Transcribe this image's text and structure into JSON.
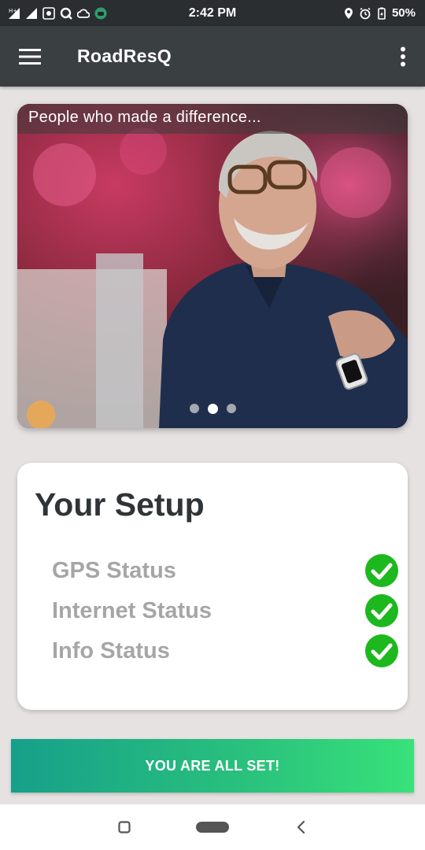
{
  "status_bar": {
    "time": "2:42 PM",
    "battery": "50%",
    "icons_left": [
      "signal-icon",
      "signal-icon",
      "app-icon",
      "q-icon",
      "cloud-icon",
      "android-icon"
    ],
    "icons_right": [
      "location-icon",
      "alarm-icon",
      "battery-icon"
    ]
  },
  "app_bar": {
    "title": "RoadResQ",
    "menu_icon": "hamburger-menu-icon",
    "overflow_icon": "more-vertical-icon",
    "color": "#3a3f41"
  },
  "carousel": {
    "caption": "People who made a difference...",
    "slide_count": 3,
    "active_slide": 2
  },
  "setup": {
    "title": "Your Setup",
    "items": [
      {
        "label": "GPS Status",
        "ok": true
      },
      {
        "label": "Internet Status",
        "ok": true
      },
      {
        "label": "Info Status",
        "ok": true
      }
    ],
    "check_color": "#1db81d"
  },
  "action_button": {
    "label": "YOU ARE ALL SET!",
    "gradient": [
      "#16a08a",
      "#38e27a"
    ]
  },
  "nav_bar": {
    "icons": [
      "recents-icon",
      "home-icon",
      "back-icon"
    ]
  }
}
